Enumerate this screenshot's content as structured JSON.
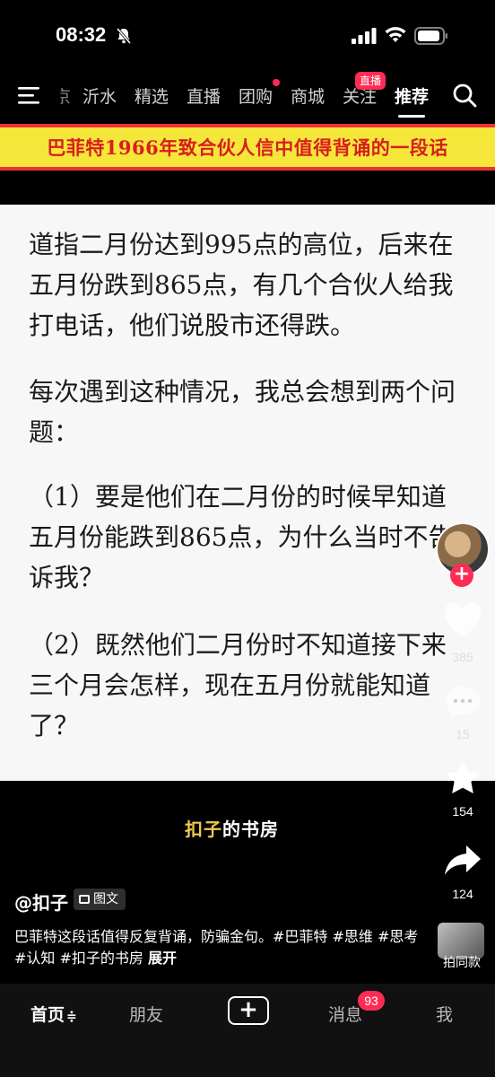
{
  "status_bar": {
    "time": "08:32"
  },
  "top_nav": {
    "tabs": [
      {
        "label": "京",
        "active": false
      },
      {
        "label": "沂水",
        "active": false
      },
      {
        "label": "精选",
        "active": false
      },
      {
        "label": "直播",
        "active": false
      },
      {
        "label": "团购",
        "active": false,
        "dot": true
      },
      {
        "label": "商城",
        "active": false
      },
      {
        "label": "关注",
        "active": false,
        "badge": "直播"
      },
      {
        "label": "推荐",
        "active": true
      }
    ]
  },
  "post": {
    "title": "巴菲特1966年致合伙人信中值得背诵的一段话",
    "paragraphs": [
      "道指二月份达到995点的高位，后来在五月份跌到865点，有几个合伙人给我打电话，他们说股市还得跌。",
      "每次遇到这种情况，我总会想到两个问题：",
      "（1）要是他们在二月份的时候早知道五月份能跌到865点，为什么当时不告诉我？",
      "（2）既然他们二月份时不知道接下来三个月会怎样，现在五月份就能知道了？"
    ],
    "watermark_a": "扣子",
    "watermark_b": "的书房"
  },
  "actions": {
    "likes": "385",
    "comments": "15",
    "favorites": "154",
    "shares": "124",
    "same_style": "拍同款"
  },
  "author": {
    "handle": "@扣子",
    "type": "图文",
    "caption": "巴菲特这段话值得反复背诵，防骗金句。#巴菲特 #思维 #思考 #认知 #扣子的书房",
    "expand": "展开"
  },
  "bottom_nav": {
    "home": "首页",
    "home_suffix": "≑",
    "friends": "朋友",
    "add": "+",
    "messages": "消息",
    "messages_badge": "93",
    "me": "我"
  }
}
